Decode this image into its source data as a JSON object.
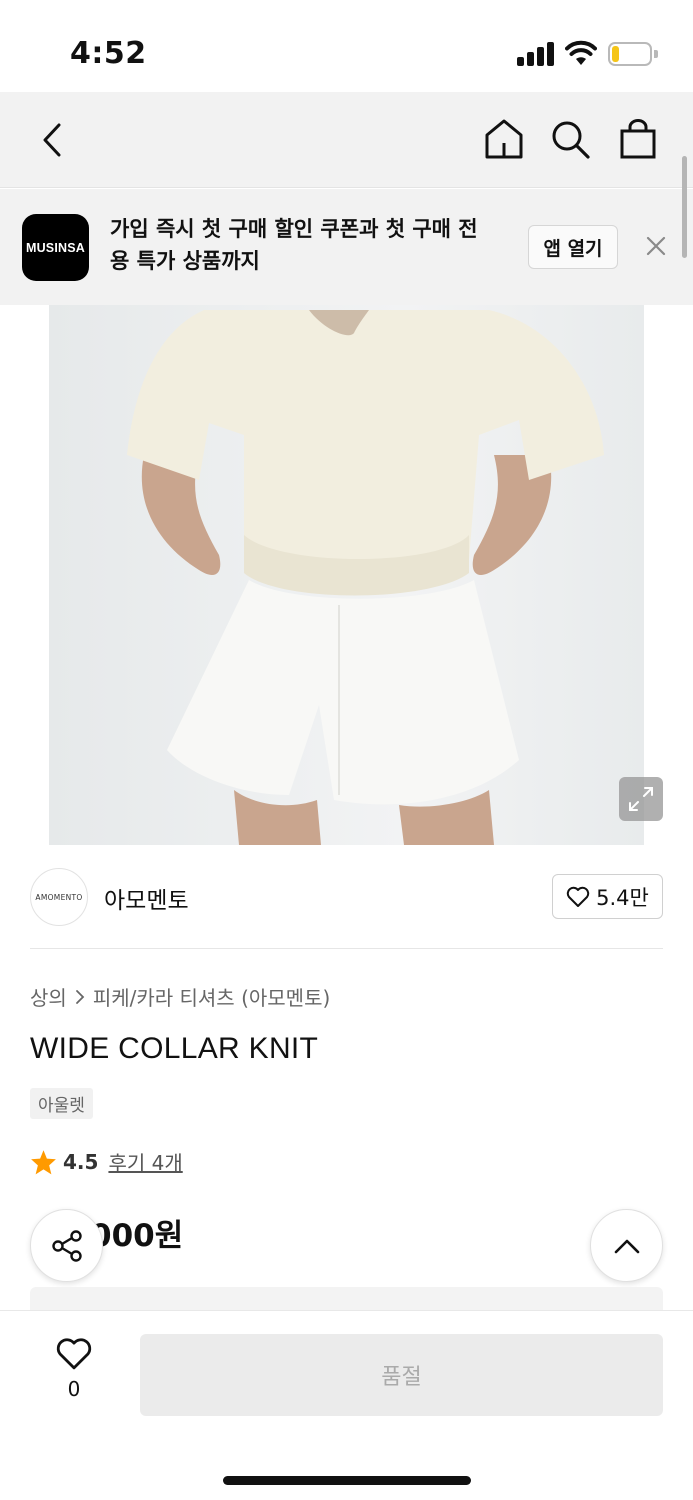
{
  "status_bar": {
    "time": "4:52",
    "signal_icon": "cellular-signal-icon",
    "wifi_icon": "wifi-icon",
    "battery_icon": "battery-low-icon",
    "battery_level": 0.2,
    "battery_color": "#f5c518"
  },
  "nav": {
    "back_icon": "chevron-left-icon",
    "home_icon": "home-icon",
    "search_icon": "search-icon",
    "cart_icon": "shopping-bag-icon"
  },
  "app_banner": {
    "logo_text": "MUSINSA",
    "message_line1": "가입 즉시 첫 구매 할인 쿠폰과 첫 구매 전",
    "message_line2": "용 특가 상품까지",
    "open_app_label": "앱 열기",
    "close_icon": "close-icon"
  },
  "product_image": {
    "expand_icon": "expand-icon"
  },
  "brand": {
    "logo_text": "AMOMENTO",
    "name": "아모멘토",
    "like_icon": "heart-outline-icon",
    "like_count": "5.4만"
  },
  "breadcrumb": {
    "category": "상의",
    "separator_icon": "chevron-right-icon",
    "subcategory": "피케/카라 티셔츠 (아모멘토)"
  },
  "product": {
    "name": "WIDE COLLAR KNIT",
    "tag": "아울렛",
    "rating_icon": "star-icon",
    "rating_color": "#ff9a00",
    "rating": "4.5",
    "review_text": "후기 4개",
    "price_partial": "000원"
  },
  "floating": {
    "share_icon": "share-icon",
    "scroll_top_icon": "chevron-up-icon"
  },
  "bottom_bar": {
    "wish_icon": "heart-outline-icon",
    "wish_count": "0",
    "soldout_label": "품절"
  }
}
